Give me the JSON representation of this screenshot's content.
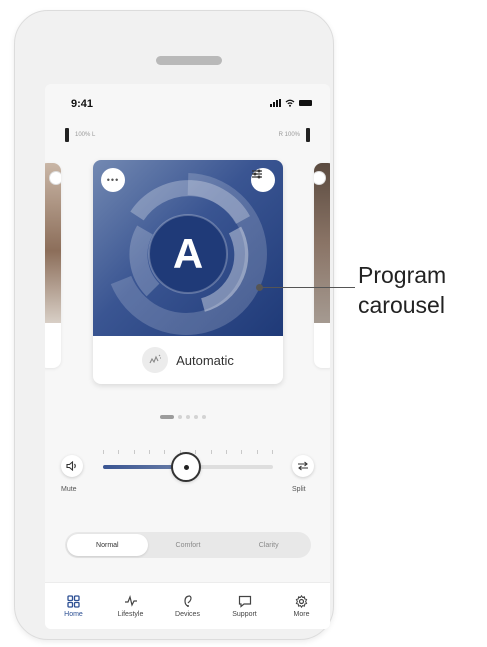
{
  "status_bar": {
    "time": "9:41"
  },
  "battery": {
    "left_label": "100% L",
    "right_label": "R 100%"
  },
  "program_card": {
    "letter": "A",
    "name": "Automatic",
    "more_label": "•••"
  },
  "carousel": {
    "page_count": 5,
    "active_index": 0
  },
  "volume": {
    "mute_label": "Mute",
    "split_label": "Split",
    "level": 0.49,
    "accent": "#3a5592"
  },
  "segments": [
    {
      "label": "Normal",
      "active": true
    },
    {
      "label": "Comfort",
      "active": false
    },
    {
      "label": "Clarity",
      "active": false
    }
  ],
  "nav": [
    {
      "label": "Home",
      "icon": "home-grid-icon",
      "active": true
    },
    {
      "label": "Lifestyle",
      "icon": "pulse-icon",
      "active": false
    },
    {
      "label": "Devices",
      "icon": "hearing-aid-icon",
      "active": false
    },
    {
      "label": "Support",
      "icon": "chat-icon",
      "active": false
    },
    {
      "label": "More",
      "icon": "gear-icon",
      "active": false
    }
  ],
  "callout": {
    "line1": "Program",
    "line2": "carousel"
  },
  "colors": {
    "brand": "#2c4f93",
    "card_gradient_dark": "#1f3a78"
  }
}
